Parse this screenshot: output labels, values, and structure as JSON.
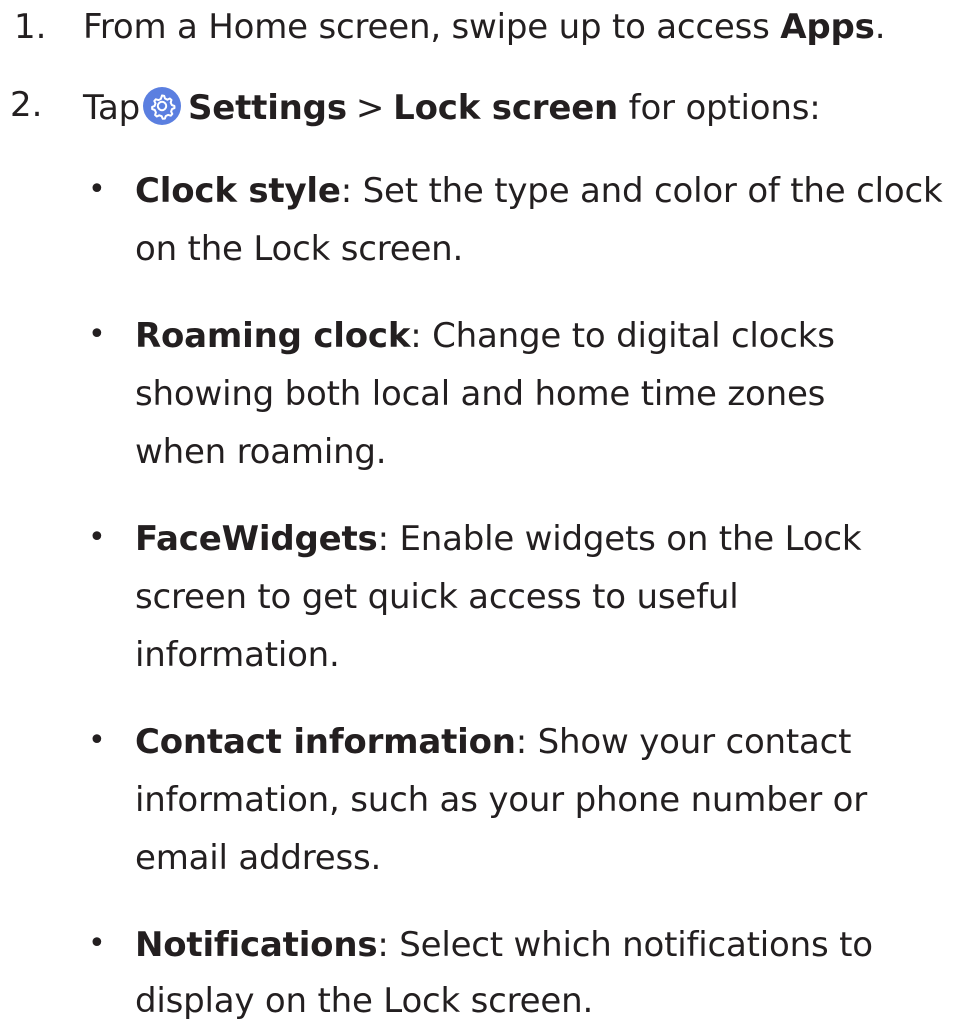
{
  "steps": [
    {
      "number": "1.",
      "text_before": "From a Home screen, swipe up to access ",
      "bold": "Apps",
      "text_after": "."
    },
    {
      "number": "2.",
      "text_before": "Tap",
      "icon": "settings-gear-icon",
      "bold_1": "Settings",
      "separator": ">",
      "bold_2": "Lock screen",
      "text_after": " for options:"
    }
  ],
  "options": [
    {
      "title": "Clock style",
      "lines": [
        ": Set the type and color of the clock",
        "on the Lock screen."
      ]
    },
    {
      "title": "Roaming clock",
      "lines": [
        ": Change to digital clocks",
        "showing both local and home time zones",
        "when roaming."
      ]
    },
    {
      "title": "FaceWidgets",
      "lines": [
        ": Enable widgets on the Lock",
        "screen to get quick access to useful",
        "information."
      ]
    },
    {
      "title": "Contact information",
      "lines": [
        ": Show your contact",
        "information, such as your phone number or",
        "email address."
      ]
    },
    {
      "title": "Notifications",
      "lines": [
        ": Select which notifications to",
        "display on the Lock screen."
      ]
    }
  ],
  "bullet_symbol": "•",
  "colors": {
    "text": "#231f20",
    "icon_bg": "#5b7fe0"
  }
}
